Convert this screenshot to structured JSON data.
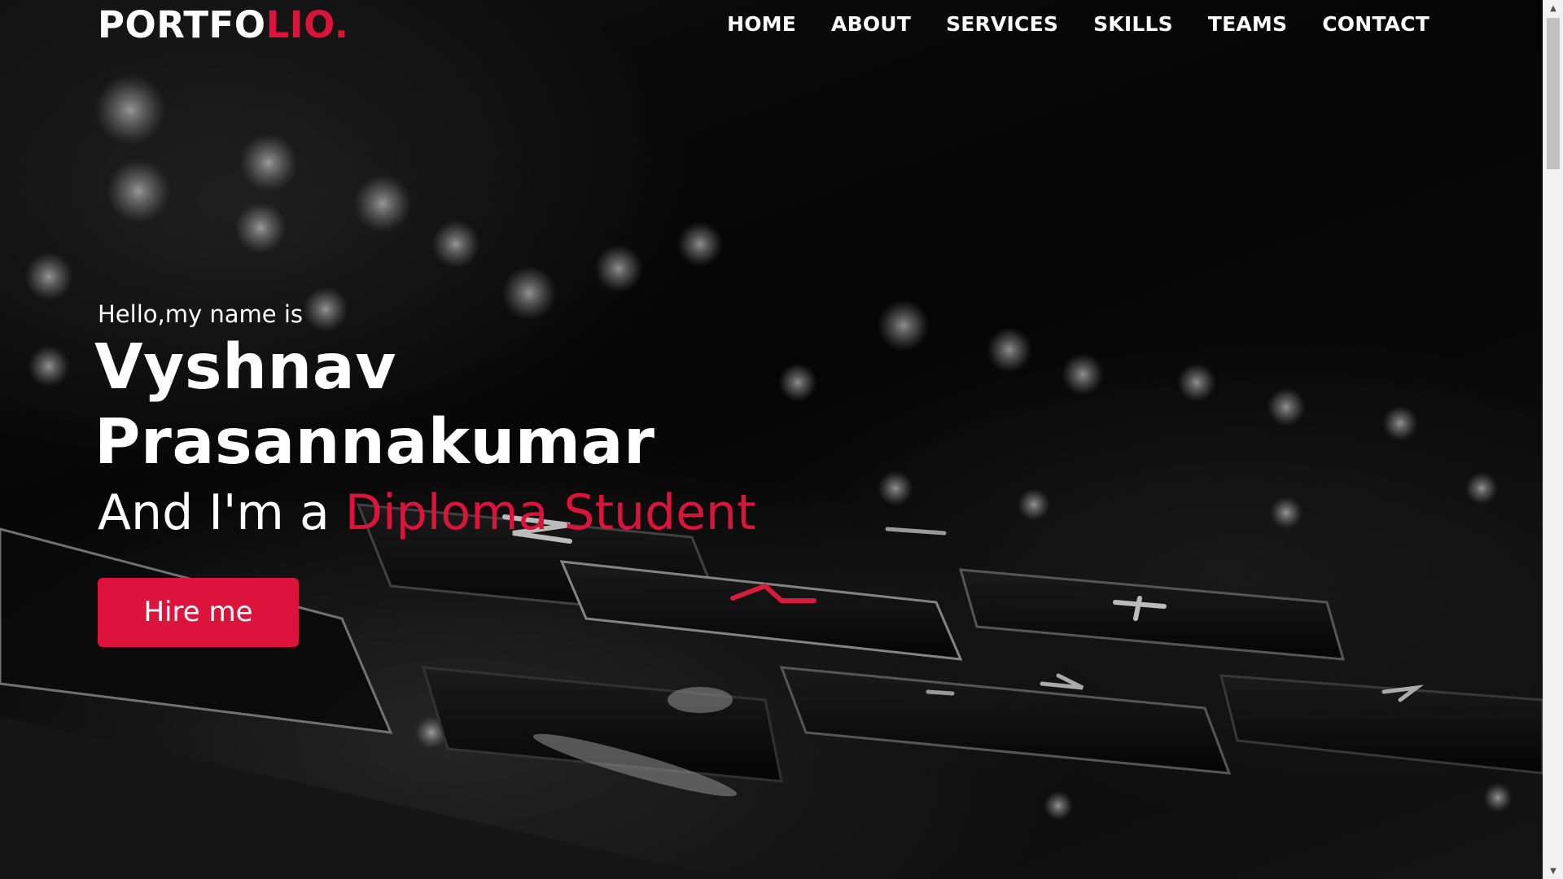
{
  "navbar": {
    "logo_main": "PORTFO",
    "logo_accent": "LIO.",
    "items": [
      {
        "label": "HOME"
      },
      {
        "label": "ABOUT"
      },
      {
        "label": "SERVICES"
      },
      {
        "label": "SKILLS"
      },
      {
        "label": "TEAMS"
      },
      {
        "label": "CONTACT"
      }
    ]
  },
  "hero": {
    "greeting": "Hello,my name is",
    "name": "Vyshnav Prasannakumar",
    "role_prefix": "And I'm a ",
    "role_accent": "Diploma Student",
    "cta_label": "Hire me"
  },
  "colors": {
    "accent": "#dc143c",
    "text": "#ffffff",
    "background": "#000000"
  },
  "scrollbar": {
    "up_icon": "chevron-up-icon",
    "down_icon": "chevron-down-icon"
  }
}
